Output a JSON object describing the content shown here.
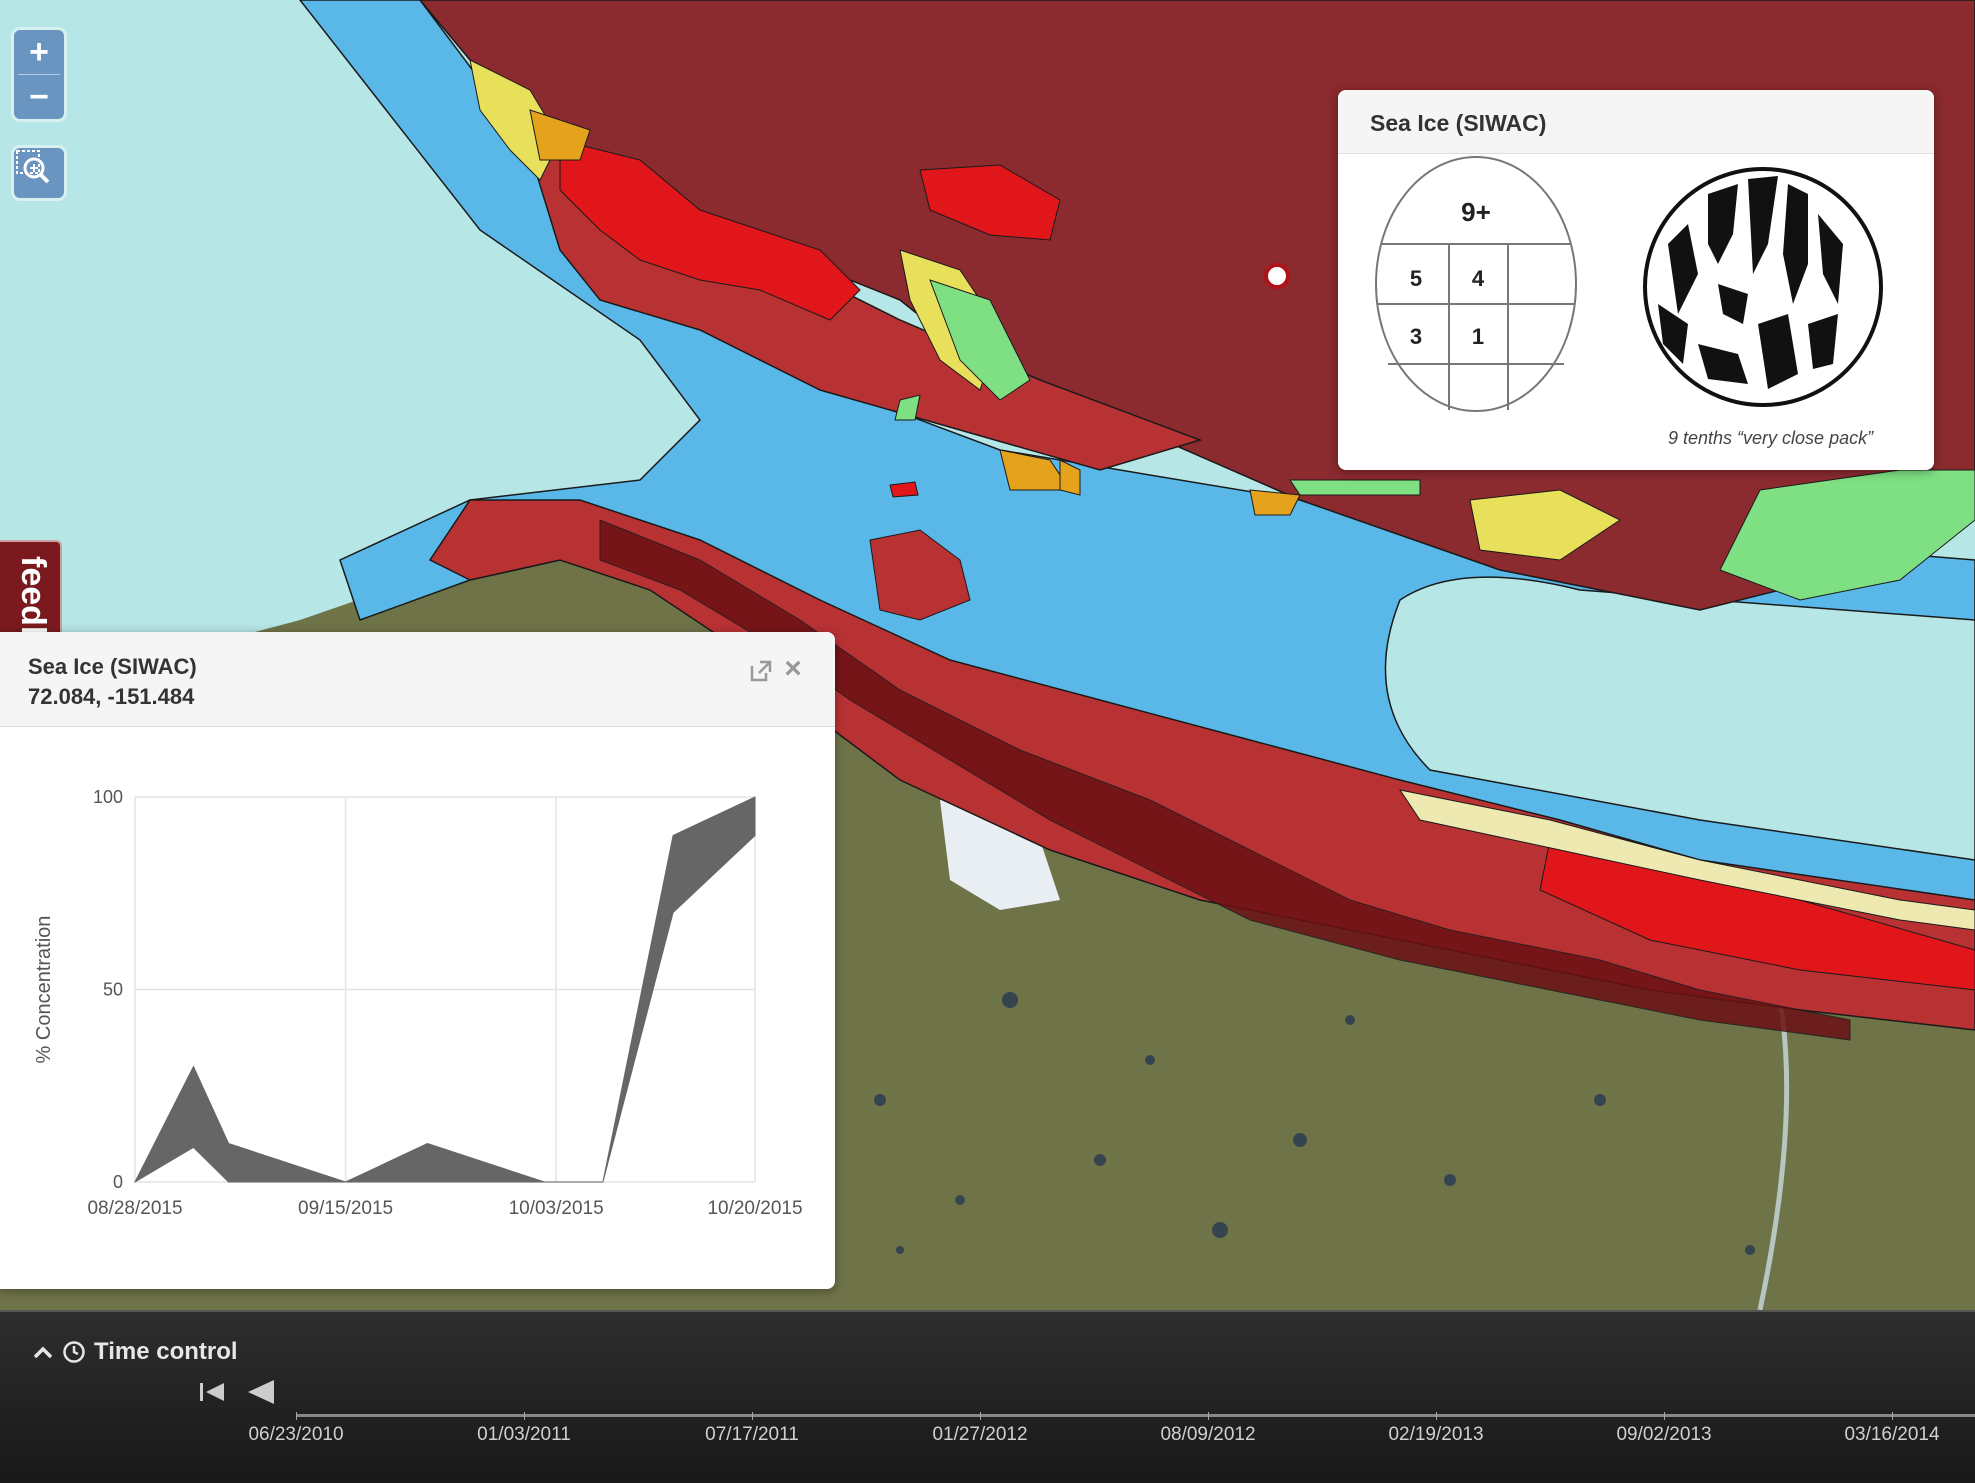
{
  "map": {
    "zoom_in_label": "+",
    "zoom_out_label": "−",
    "feedback_label": "feedback"
  },
  "legend_popup": {
    "title": "Sea Ice (SIWAC)",
    "egg_code": {
      "top": "9+",
      "row1_left": "5",
      "row1_right": "4",
      "row2_left": "3",
      "row2_right": "1"
    },
    "caption": "9 tenths “very close pack”"
  },
  "chart_popup": {
    "title": "Sea Ice (SIWAC)",
    "coordinates": "72.084, -151.484"
  },
  "chart_data": {
    "type": "area",
    "title": "",
    "xlabel": "",
    "ylabel": "% Concentration",
    "ylim": [
      0,
      100
    ],
    "xlim": [
      "08/28/2015",
      "10/20/2015"
    ],
    "x_ticks": [
      "08/28/2015",
      "09/15/2015",
      "10/03/2015",
      "10/20/2015"
    ],
    "y_ticks": [
      "0",
      "50",
      "100"
    ],
    "grid": true,
    "series": [
      {
        "x": [
          "08/28/2015",
          "09/02/2015",
          "09/05/2015",
          "09/15/2015",
          "09/22/2015",
          "10/02/2015",
          "10/07/2015",
          "10/13/2015",
          "10/20/2015"
        ],
        "upper": [
          0,
          30,
          10,
          0,
          10,
          0,
          0,
          90,
          100
        ],
        "lower": [
          0,
          9,
          0,
          0,
          0,
          0,
          0,
          70,
          90
        ],
        "color": "#666666"
      }
    ]
  },
  "time_control": {
    "title": "Time control",
    "dates": [
      "06/23/2010",
      "01/03/2011",
      "07/17/2011",
      "01/27/2012",
      "08/09/2012",
      "02/19/2013",
      "09/02/2013",
      "03/16/2014"
    ]
  }
}
